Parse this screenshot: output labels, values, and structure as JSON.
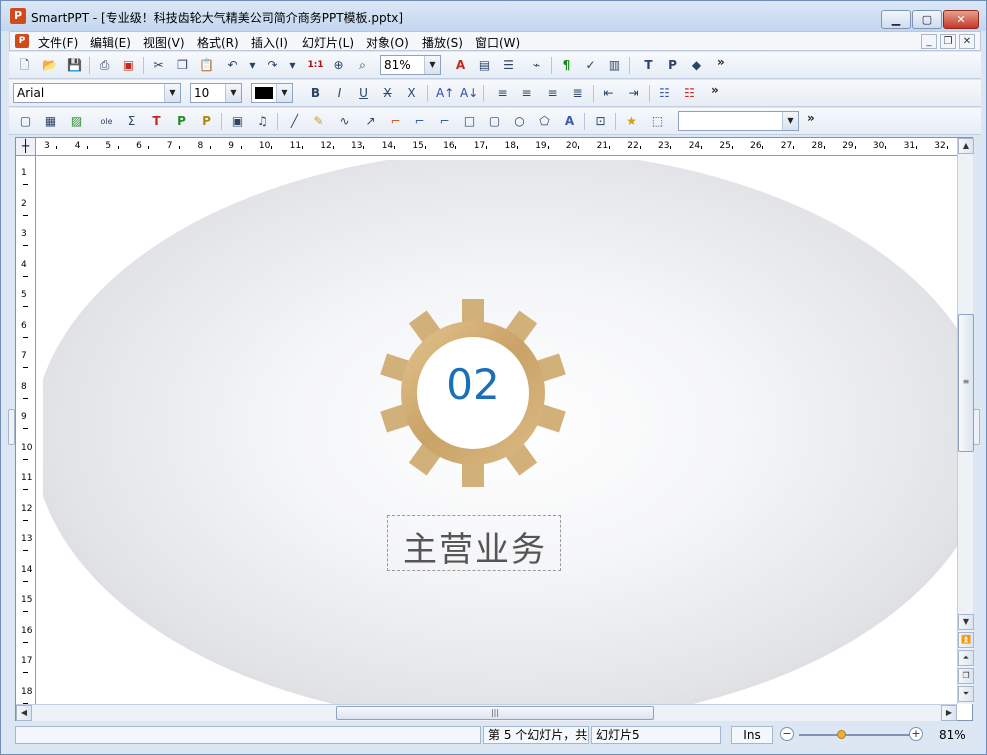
{
  "window": {
    "title": "SmartPPT - [专业级！科技齿轮大气精美公司简介商务PPT模板.pptx]",
    "app_icon": "P",
    "minimize_icon": "minimize-icon",
    "maximize_icon": "maximize-icon",
    "close_icon": "close-icon"
  },
  "menu": {
    "doc_icon": "P",
    "items": [
      "文件(F)",
      "编辑(E)",
      "视图(V)",
      "格式(R)",
      "插入(I)",
      "幻灯片(L)",
      "对象(O)",
      "播放(S)",
      "窗口(W)"
    ]
  },
  "toolbar1": {
    "zoom_value": "81%",
    "overflow": "»"
  },
  "toolbar2": {
    "font_name": "Arial",
    "font_size": "10",
    "overflow": "»"
  },
  "toolbar3": {
    "style_value": "",
    "overflow": "»"
  },
  "ruler": {
    "h_numbers": [
      "3",
      "4",
      "5",
      "6",
      "7",
      "8",
      "9",
      "10",
      "11",
      "12",
      "13",
      "14",
      "15",
      "16",
      "17",
      "18",
      "19",
      "20",
      "21",
      "22",
      "23",
      "24",
      "25",
      "26",
      "27",
      "28",
      "29",
      "30",
      "31",
      "32"
    ],
    "v_numbers": [
      "1",
      "2",
      "3",
      "4",
      "5",
      "6",
      "7",
      "8",
      "9",
      "10",
      "11",
      "12",
      "13",
      "14",
      "15",
      "16",
      "17",
      "18"
    ]
  },
  "slide": {
    "number": "02",
    "title": "主营业务",
    "gear_color": "#d2b07a",
    "number_color": "#1a6fb8"
  },
  "status": {
    "slide_info": "第 5 个幻灯片，共",
    "slide_name": "幻灯片5",
    "mode": "Ins",
    "zoom": "81%"
  }
}
